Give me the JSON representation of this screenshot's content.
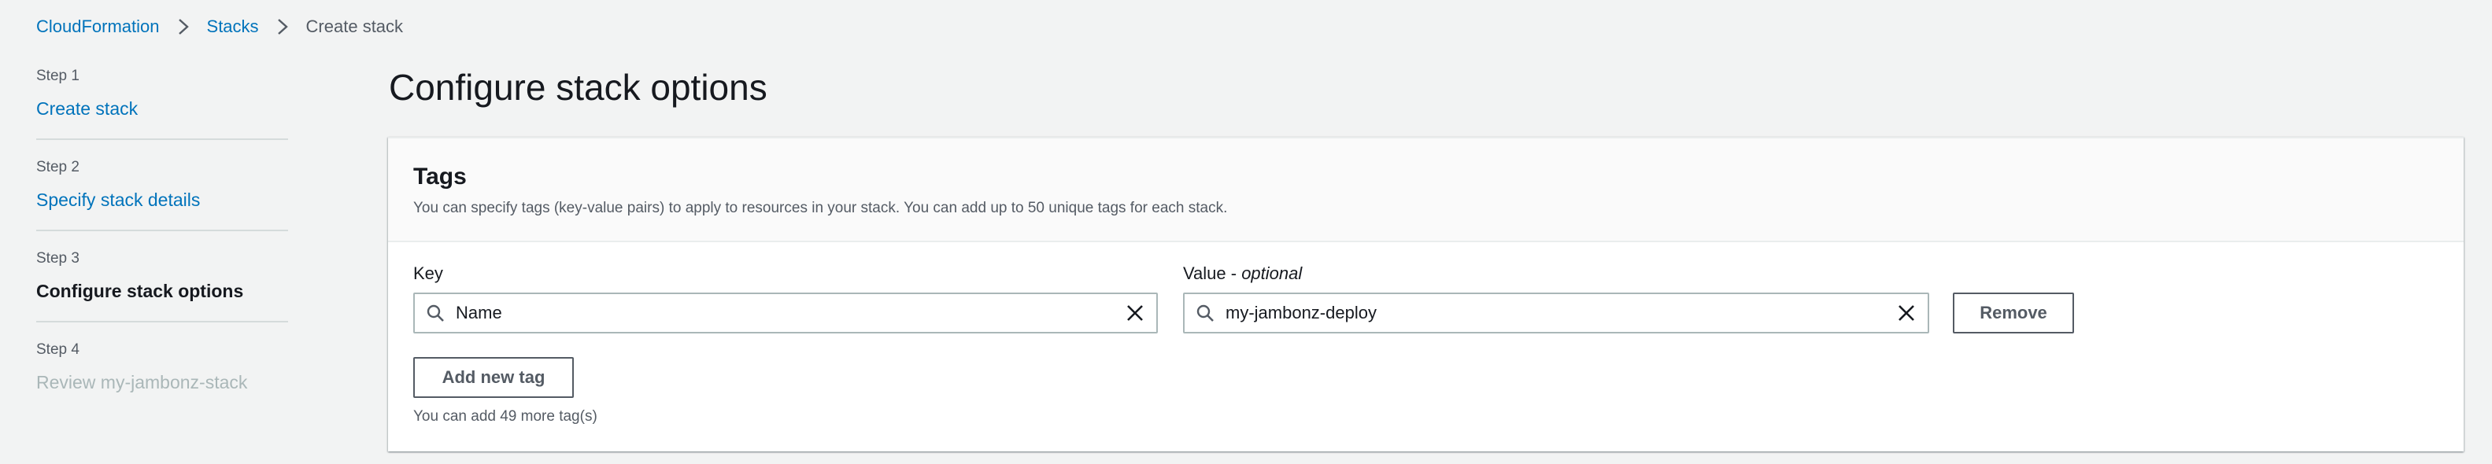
{
  "breadcrumb": {
    "items": [
      {
        "label": "CloudFormation"
      },
      {
        "label": "Stacks"
      },
      {
        "label": "Create stack"
      }
    ]
  },
  "steps": [
    {
      "number": "Step 1",
      "title": "Create stack",
      "state": "link"
    },
    {
      "number": "Step 2",
      "title": "Specify stack details",
      "state": "link"
    },
    {
      "number": "Step 3",
      "title": "Configure stack options",
      "state": "current"
    },
    {
      "number": "Step 4",
      "title": "Review my-jambonz-stack",
      "state": "disabled"
    }
  ],
  "page": {
    "title": "Configure stack options"
  },
  "tags_panel": {
    "title": "Tags",
    "description": "You can specify tags (key-value pairs) to apply to resources in your stack. You can add up to 50 unique tags for each stack.",
    "key_label": "Key",
    "value_label_main": "Value - ",
    "value_label_optional": "optional",
    "rows": [
      {
        "key": "Name",
        "value": "my-jambonz-deploy"
      }
    ],
    "remove_label": "Remove",
    "add_label": "Add new tag",
    "remaining_hint": "You can add 49 more tag(s)"
  },
  "colors": {
    "link": "#0073bb",
    "background": "#f2f3f3",
    "text": "#16191f",
    "secondary_text": "#545b64",
    "disabled": "#aab7b8"
  },
  "icons": {
    "breadcrumb_separator": "chevron-right-icon",
    "input_prefix": "search-icon",
    "input_clear": "close-icon"
  }
}
